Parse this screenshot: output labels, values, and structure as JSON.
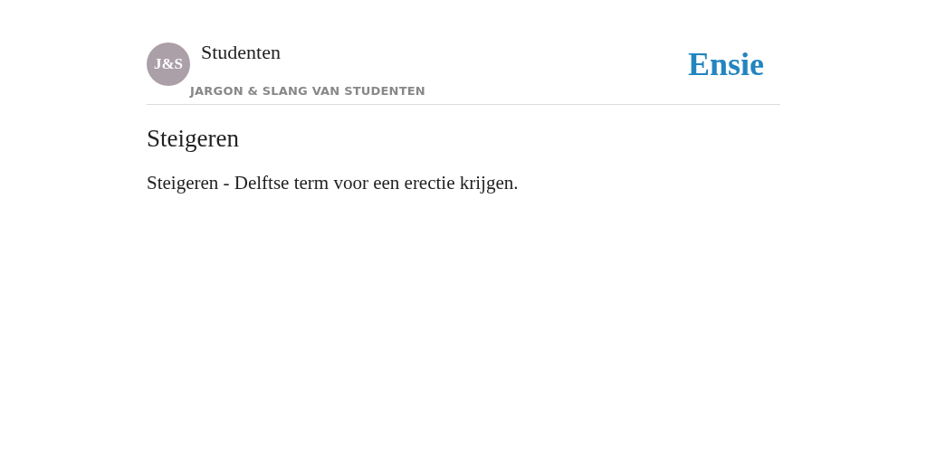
{
  "header": {
    "avatar": "J&S",
    "category": "Studenten",
    "subtitle": "JARGON & SLANG VAN STUDENTEN",
    "logo": "Ensie"
  },
  "article": {
    "title": "Steigeren",
    "body": "Steigeren - Delftse term voor een erectie krijgen."
  }
}
